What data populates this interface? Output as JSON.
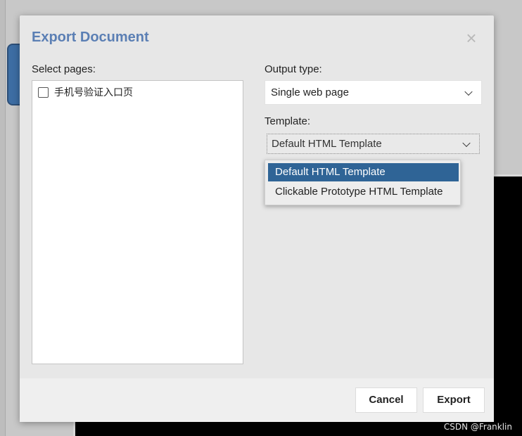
{
  "dialog": {
    "title": "Export Document",
    "close_glyph": "×",
    "select_pages_label": "Select pages:",
    "pages": [
      {
        "label": "手机号验证入口页",
        "checked": false
      }
    ],
    "output_type_label": "Output type:",
    "output_type_value": "Single web page",
    "template_label": "Template:",
    "template_value": "Default HTML Template",
    "template_options": [
      {
        "label": "Default HTML Template",
        "selected": true
      },
      {
        "label": "Clickable Prototype HTML Template",
        "selected": false
      }
    ],
    "cancel_label": "Cancel",
    "export_label": "Export"
  },
  "watermark": "CSDN @Franklin",
  "colors": {
    "title": "#5b7fb4",
    "selected_option": "#2f6496",
    "background": "#c8c8c8",
    "dialog": "#e7e7e7"
  },
  "icons": {
    "close": "close-icon",
    "dropdown": "chevron-down-icon",
    "checkbox": "checkbox-icon"
  }
}
